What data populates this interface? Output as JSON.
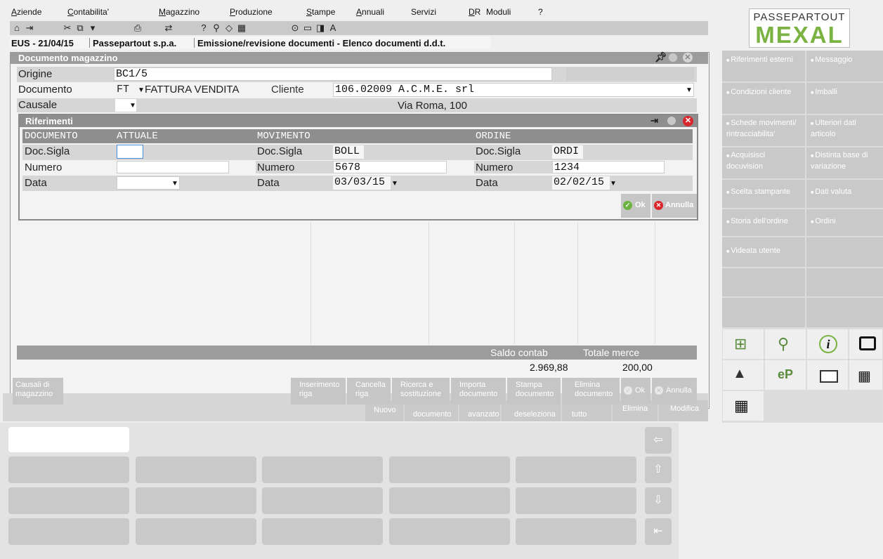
{
  "menu": [
    "Aziende",
    "Contabilita'",
    "Magazzino",
    "Produzione",
    "Stampe",
    "Annuali",
    "Servizi",
    "DR",
    "Moduli",
    "?"
  ],
  "tabbar": {
    "company": "EUS - 21/04/15",
    "firm": "Passepartout s.p.a.",
    "path": "Emissione/revisione documenti - Elenco documenti d.d.t."
  },
  "logo": {
    "line1": "PASSEPARTOUT",
    "line2": "MEXAL"
  },
  "window": {
    "title": "Documento magazzino",
    "origine_label": "Origine",
    "origine_value": "BC1/5",
    "documento_label": "Documento",
    "documento_code": "FT",
    "documento_desc": "FATTURA VENDITA",
    "cliente_label": "Cliente",
    "cliente_value": "106.02009 A.C.M.E. srl",
    "causale_label": "Causale",
    "address": "Via Roma, 100"
  },
  "dialog": {
    "title": "Riferimenti",
    "col_documento": "DOCUMENTO",
    "col_attuale": "ATTUALE",
    "col_movimento": "MOVIMENTO",
    "col_ordine": "ORDINE",
    "doc_sigla_label": "Doc.Sigla",
    "numero_label": "Numero",
    "data_label": "Data",
    "attuale": {
      "sigla": "",
      "numero": "",
      "data": ""
    },
    "movimento": {
      "sigla": "BOLL",
      "numero": "5678",
      "data": "03/03/15"
    },
    "ordine": {
      "sigla": "ORDI",
      "numero": "1234",
      "data": "02/02/15"
    },
    "ok": "Ok",
    "annulla": "Annulla"
  },
  "totals": {
    "saldo_label": "Saldo contab",
    "saldo_value": "2.969,88",
    "totale_label": "Totale merce",
    "totale_value": "200,00"
  },
  "bottom_buttons": {
    "causali": "Causali di magazzino",
    "inserimento": "Inserimento riga",
    "cancella": "Cancella riga",
    "ricerca": "Ricerca e sostituzione",
    "importa": "Importa documento",
    "stampa": "Stampa documento",
    "elimina": "Elimina documento",
    "ok": "Ok",
    "annulla": "Annulla"
  },
  "back_buttons": {
    "nuovo": "Nuovo",
    "documento": "documento",
    "avanzato": "avanzato",
    "deseleziona": "deseleziona",
    "tutto": "tutto",
    "elimina": "Elimina",
    "modifica": "Modifica"
  },
  "right_panel": [
    "Riferimenti esterni",
    "Messaggio",
    "Condizioni cliente",
    "Imballi",
    "Schede movimenti/ rintracciabilita'",
    "Ulteriori dati articolo",
    "Acquisisci docuvision",
    "Distinta base di variazione",
    "Scelta stampante",
    "Dati valuta",
    "Storia dell'ordine",
    "Ordini",
    "Videata utente",
    ""
  ],
  "icons": [
    "chart-import-icon",
    "search-document-icon",
    "info-icon",
    "monitor-icon",
    "chart-warning-icon",
    "ep-lock-icon",
    "card-icon",
    "keyboard-icon",
    "grid-icon"
  ]
}
